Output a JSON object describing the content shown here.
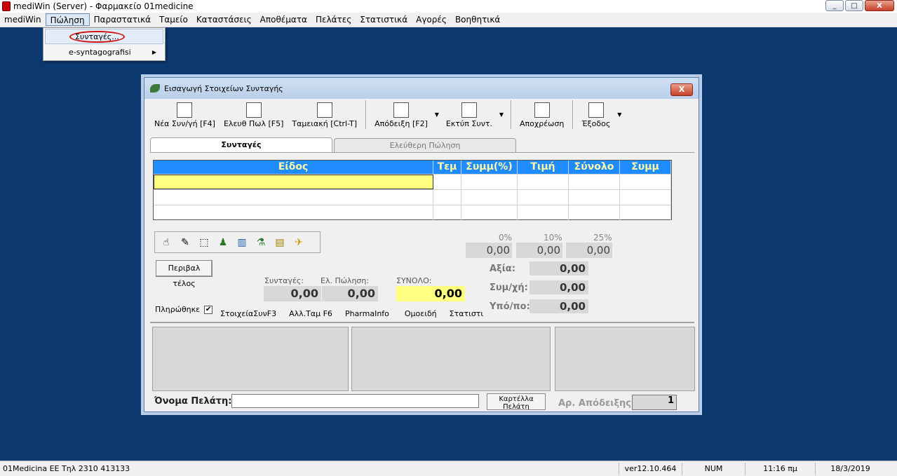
{
  "app": {
    "title": "mediWin (Server) - Φαρμακείο 01medicine",
    "window_buttons": [
      "_",
      "□",
      "X"
    ]
  },
  "menubar": {
    "items": [
      "mediWin",
      "Πώληση",
      "Παραστατικά",
      "Ταμείο",
      "Καταστάσεις",
      "Αποθέματα",
      "Πελάτες",
      "Στατιστικά",
      "Αγορές",
      "Βοηθητικά"
    ],
    "active_index": 1
  },
  "dropdown": {
    "items": [
      {
        "label": "Συνταγές..."
      },
      {
        "label": "e-syntagografisi"
      }
    ],
    "submenu_arrow": "▶"
  },
  "dialog": {
    "title": "Εισαγωγή Στοιχείων Συνταγής",
    "close": "X",
    "toolbar": {
      "buttons": [
        "Νέα Συν/γή [F4]",
        "Ελευθ Πωλ [F5]",
        "Ταμειακή [Ctrl-T]",
        "Απόδειξη [F2]",
        "Εκτύπ Συντ.",
        "Αποχρέωση",
        "Έξοδος"
      ],
      "drop_arrow": "▼"
    },
    "tabs": [
      "Συνταγές",
      "Ελεύθερη Πώληση"
    ],
    "grid": {
      "headers": [
        "Είδος",
        "Τεμ",
        "Συμμ(%)",
        "Τιμή",
        "Σύνολο",
        "Συμμ"
      ]
    },
    "rates": {
      "labels": [
        "0%",
        "10%",
        "25%"
      ],
      "values": [
        "0,00",
        "0,00",
        "0,00"
      ]
    },
    "summary": {
      "axia_label": "Αξία:",
      "axia_value": "0,00",
      "symxi_label": "Συμ/χή:",
      "symxi_value": "0,00",
      "ypopo_label": "Υπό/πο:",
      "ypopo_value": "0,00"
    },
    "peri_button": "Περιβαλ τέλος",
    "totals": {
      "syntages_label": "Συνταγές:",
      "syntages_value": "0,00",
      "elpolisi_label": "Ελ. Πώληση:",
      "elpolisi_value": "0,00",
      "synolo_label": "ΣΥΝΟΛΟ:",
      "synolo_value": "0,00"
    },
    "paid_label": "Πληρώθηκε",
    "paid_check": "✔",
    "links": [
      "ΣτοιχείαΣυνF3",
      "Αλλ.Ταμ F6",
      "PharmaInfo",
      "Ομοειδή",
      "Στατιστι"
    ],
    "customer_label": "Όνομα Πελάτη:",
    "customer_value": "",
    "card_button": "Καρτέλλα Πελάτη",
    "receipt_label": "Αρ. Απόδειξης:",
    "receipt_value": "1"
  },
  "statusbar": {
    "company": "01Medicina ΕΕ   Τηλ 2310 413133",
    "version": "ver12.10.464",
    "num": "NUM",
    "time": "11:16 πμ",
    "date": "18/3/2019"
  }
}
